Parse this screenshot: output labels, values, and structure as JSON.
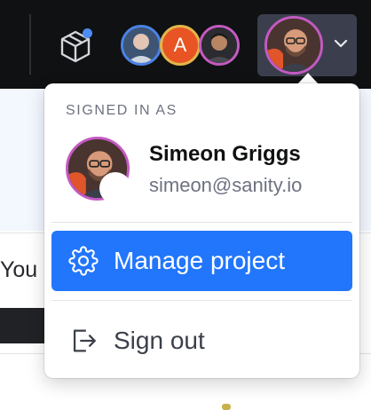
{
  "topbar": {
    "icons": {
      "cube": "cube-icon",
      "chevron": "chevron-down-icon"
    },
    "avatars": [
      {
        "initial": "",
        "ring": "#4b82e8"
      },
      {
        "initial": "A",
        "ring": "#e3b64a",
        "fill": "#e85424"
      },
      {
        "initial": "",
        "ring": "#c45ac2"
      }
    ],
    "current_user_ring": "#c45ac2",
    "notification_dot": "#4d8cf5"
  },
  "background": {
    "partial_text": "You"
  },
  "menu": {
    "heading": "SIGNED IN AS",
    "user": {
      "name": "Simeon Griggs",
      "email": "simeon@sanity.io"
    },
    "items": [
      {
        "label": "Manage project",
        "icon": "gear-icon",
        "active": true
      },
      {
        "label": "Sign out",
        "icon": "sign-out-icon",
        "active": false
      }
    ]
  },
  "colors": {
    "topbar_bg": "#101112",
    "accent": "#2276fc",
    "muted_text": "#6e7280"
  }
}
